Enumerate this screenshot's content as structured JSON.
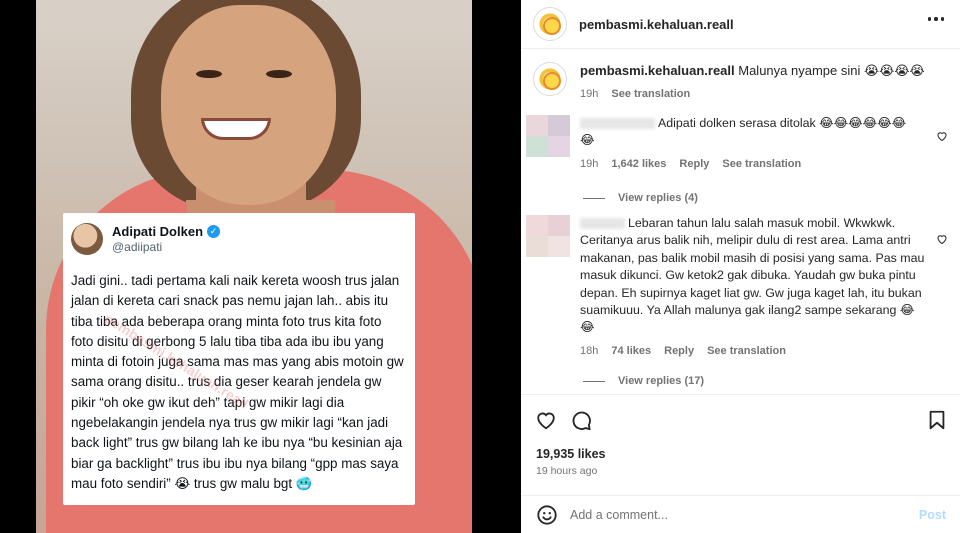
{
  "post": {
    "username": "pembasmi.kehaluan.reall",
    "caption": "Malunya nyampe sini 😭😭😭😭",
    "caption_time": "19h",
    "see_translation": "See translation",
    "likes": "19,935 likes",
    "time_ago": "19 hours ago",
    "add_comment_placeholder": "Add a comment...",
    "post_label": "Post"
  },
  "comments": [
    {
      "text": "Adipati dolken serasa ditolak 😂😂😂😂😂😂😂",
      "time": "19h",
      "likes": "1,642 likes",
      "reply": "Reply",
      "see_translation": "See translation",
      "view_replies": "View replies (4)"
    },
    {
      "text": "Lebaran tahun lalu salah masuk mobil. Wkwkwk. Ceritanya arus balik nih, melipir dulu di rest area. Lama antri makanan, pas balik mobil masih di posisi yang sama. Pas mau masuk dikunci. Gw ketok2 gak dibuka. Yaudah gw buka pintu depan. Eh supirnya kaget liat gw. Gw juga kaget lah, itu bukan suamikuuu. Ya Allah malunya gak ilang2 sampe sekarang 😂😂",
      "time": "18h",
      "likes": "74 likes",
      "reply": "Reply",
      "see_translation": "See translation",
      "view_replies": "View replies (17)"
    }
  ],
  "tweet": {
    "name": "Adipati Dolken",
    "handle": "@adiipati",
    "body": "Jadi gini.. tadi pertama kali naik kereta woosh trus jalan jalan di kereta cari snack pas nemu jajan lah.. abis itu tiba tiba ada beberapa orang minta foto trus kita foto foto disitu di gerbong 5 lalu tiba tiba ada ibu ibu yang minta di fotoin juga sama mas mas yang abis motoin gw sama orang disitu.. trus dia geser kearah jendela gw pikir “oh oke gw ikut deh” tapi gw mikir lagi dia ngebelakangin jendela nya trus gw mikir lagi “kan jadi back light” trus gw bilang lah ke ibu nya “bu kesinian aja biar ga backlight” trus ibu ibu nya bilang “gpp mas saya mau foto sendiri” 😭 trus gw malu bgt 🥶"
  },
  "watermark": "pembasmi.kehaluan.reall",
  "colors": {
    "accent": "#0095f6",
    "post_disabled": "#b3dbff",
    "shirt": "#e4766e"
  }
}
